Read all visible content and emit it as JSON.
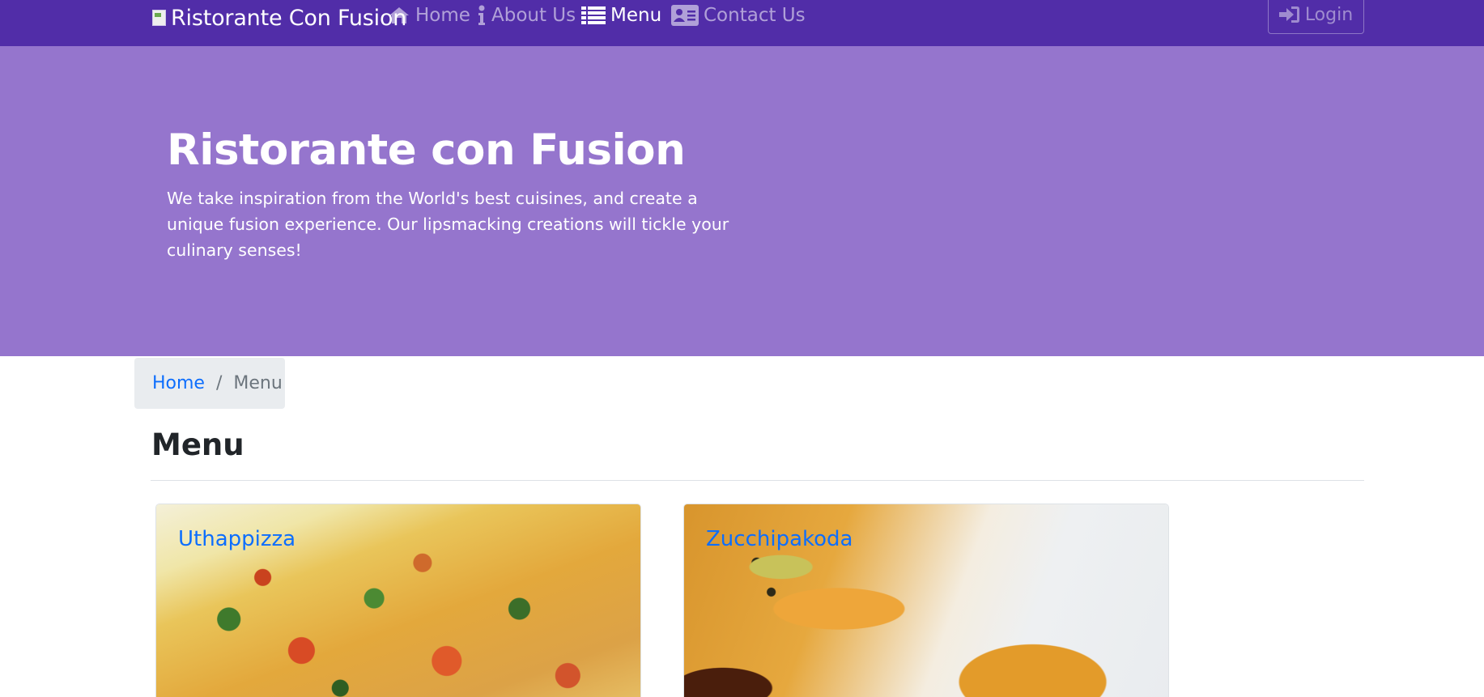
{
  "navbar": {
    "brand": "Ristorante Con Fusion",
    "brand_logo_icon": "broken-image-icon",
    "items": [
      {
        "label": "Home",
        "icon": "home-icon",
        "active": false
      },
      {
        "label": "About Us",
        "icon": "info-icon",
        "active": false
      },
      {
        "label": "Menu",
        "icon": "list-icon",
        "active": true
      },
      {
        "label": "Contact Us",
        "icon": "address-card-icon",
        "active": false
      }
    ],
    "login_label": "Login",
    "login_icon": "sign-in-icon"
  },
  "jumbotron": {
    "title": "Ristorante con Fusion",
    "text": "We take inspiration from the World's best cuisines, and create a unique fusion experience. Our lipsmacking creations will tickle your culinary senses!"
  },
  "breadcrumb": {
    "home": "Home",
    "separator": "/",
    "current": "Menu"
  },
  "page": {
    "heading": "Menu"
  },
  "menu_items": [
    {
      "name": "Uthappizza"
    },
    {
      "name": "Zucchipakoda"
    }
  ],
  "colors": {
    "navbar": "#512DA8",
    "jumbotron": "#9575CD",
    "link": "#0d6efd",
    "breadcrumb_bg": "#e9ecef"
  }
}
